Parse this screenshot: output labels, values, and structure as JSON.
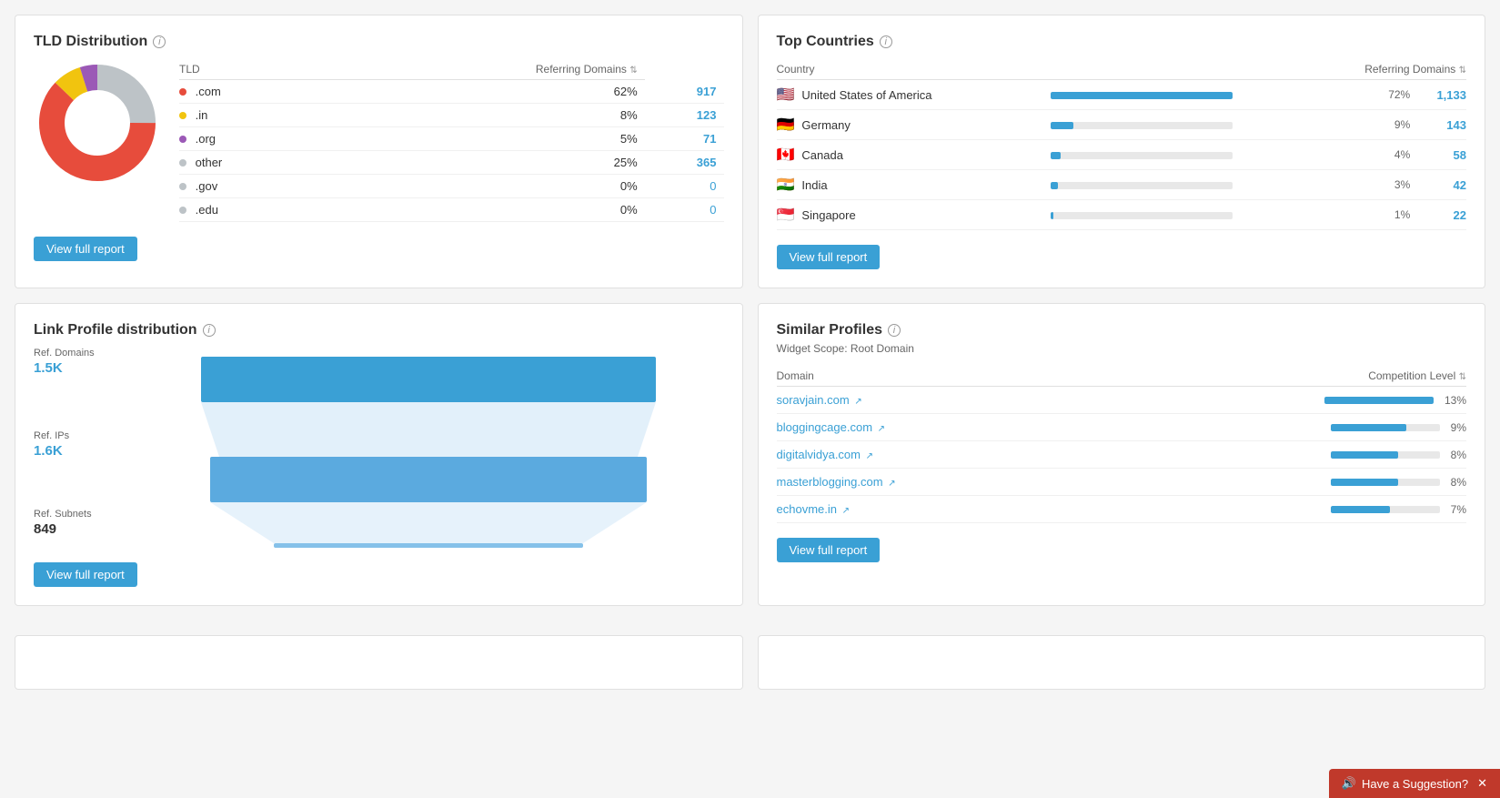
{
  "tld_distribution": {
    "title": "TLD Distribution",
    "table_headers": {
      "tld": "TLD",
      "referring_domains": "Referring Domains"
    },
    "rows": [
      {
        "id": "com",
        "label": ".com",
        "color": "#e74c3c",
        "pct": "62%",
        "count": "917"
      },
      {
        "id": "in",
        "label": ".in",
        "color": "#f1c40f",
        "pct": "8%",
        "count": "123"
      },
      {
        "id": "org",
        "label": ".org",
        "color": "#9b59b6",
        "pct": "5%",
        "count": "71"
      },
      {
        "id": "other",
        "label": "other",
        "color": "#bdc3c7",
        "pct": "25%",
        "count": "365"
      },
      {
        "id": "gov",
        "label": ".gov",
        "color": "#bdc3c7",
        "pct": "0%",
        "count": "0"
      },
      {
        "id": "edu",
        "label": ".edu",
        "color": "#bdc3c7",
        "pct": "0%",
        "count": "0"
      }
    ],
    "view_full_report": "View full report"
  },
  "top_countries": {
    "title": "Top Countries",
    "table_headers": {
      "country": "Country",
      "referring_domains": "Referring Domains"
    },
    "rows": [
      {
        "id": "us",
        "flag": "🇺🇸",
        "name": "United States of America",
        "pct": "72%",
        "pct_num": 72,
        "count": "1,133"
      },
      {
        "id": "de",
        "flag": "🇩🇪",
        "name": "Germany",
        "pct": "9%",
        "pct_num": 9,
        "count": "143"
      },
      {
        "id": "ca",
        "flag": "🇨🇦",
        "name": "Canada",
        "pct": "4%",
        "pct_num": 4,
        "count": "58"
      },
      {
        "id": "in",
        "flag": "🇮🇳",
        "name": "India",
        "pct": "3%",
        "pct_num": 3,
        "count": "42"
      },
      {
        "id": "sg",
        "flag": "🇸🇬",
        "name": "Singapore",
        "pct": "1%",
        "pct_num": 1,
        "count": "22"
      }
    ],
    "view_full_report": "View full report"
  },
  "link_profile": {
    "title": "Link Profile distribution",
    "ref_domains_label": "Ref. Domains",
    "ref_domains_value": "1.5K",
    "ref_ips_label": "Ref. IPs",
    "ref_ips_value": "1.6K",
    "ref_subnets_label": "Ref. Subnets",
    "ref_subnets_value": "849",
    "view_full_report": "View full report"
  },
  "similar_profiles": {
    "title": "Similar Profiles",
    "widget_scope": "Widget Scope: Root Domain",
    "table_headers": {
      "domain": "Domain",
      "competition_level": "Competition Level"
    },
    "rows": [
      {
        "id": "soravjain",
        "domain": "soravjain.com",
        "pct": "13%",
        "pct_num": 13
      },
      {
        "id": "bloggingcage",
        "domain": "bloggingcage.com",
        "pct": "9%",
        "pct_num": 9
      },
      {
        "id": "digitalvidya",
        "domain": "digitalvidya.com",
        "pct": "8%",
        "pct_num": 8
      },
      {
        "id": "masterblogging",
        "domain": "masterblogging.com",
        "pct": "8%",
        "pct_num": 8
      },
      {
        "id": "echovme",
        "domain": "echovme.in",
        "pct": "7%",
        "pct_num": 7
      }
    ],
    "view_full_report": "View full report"
  },
  "suggestion_btn": "Have a Suggestion?"
}
